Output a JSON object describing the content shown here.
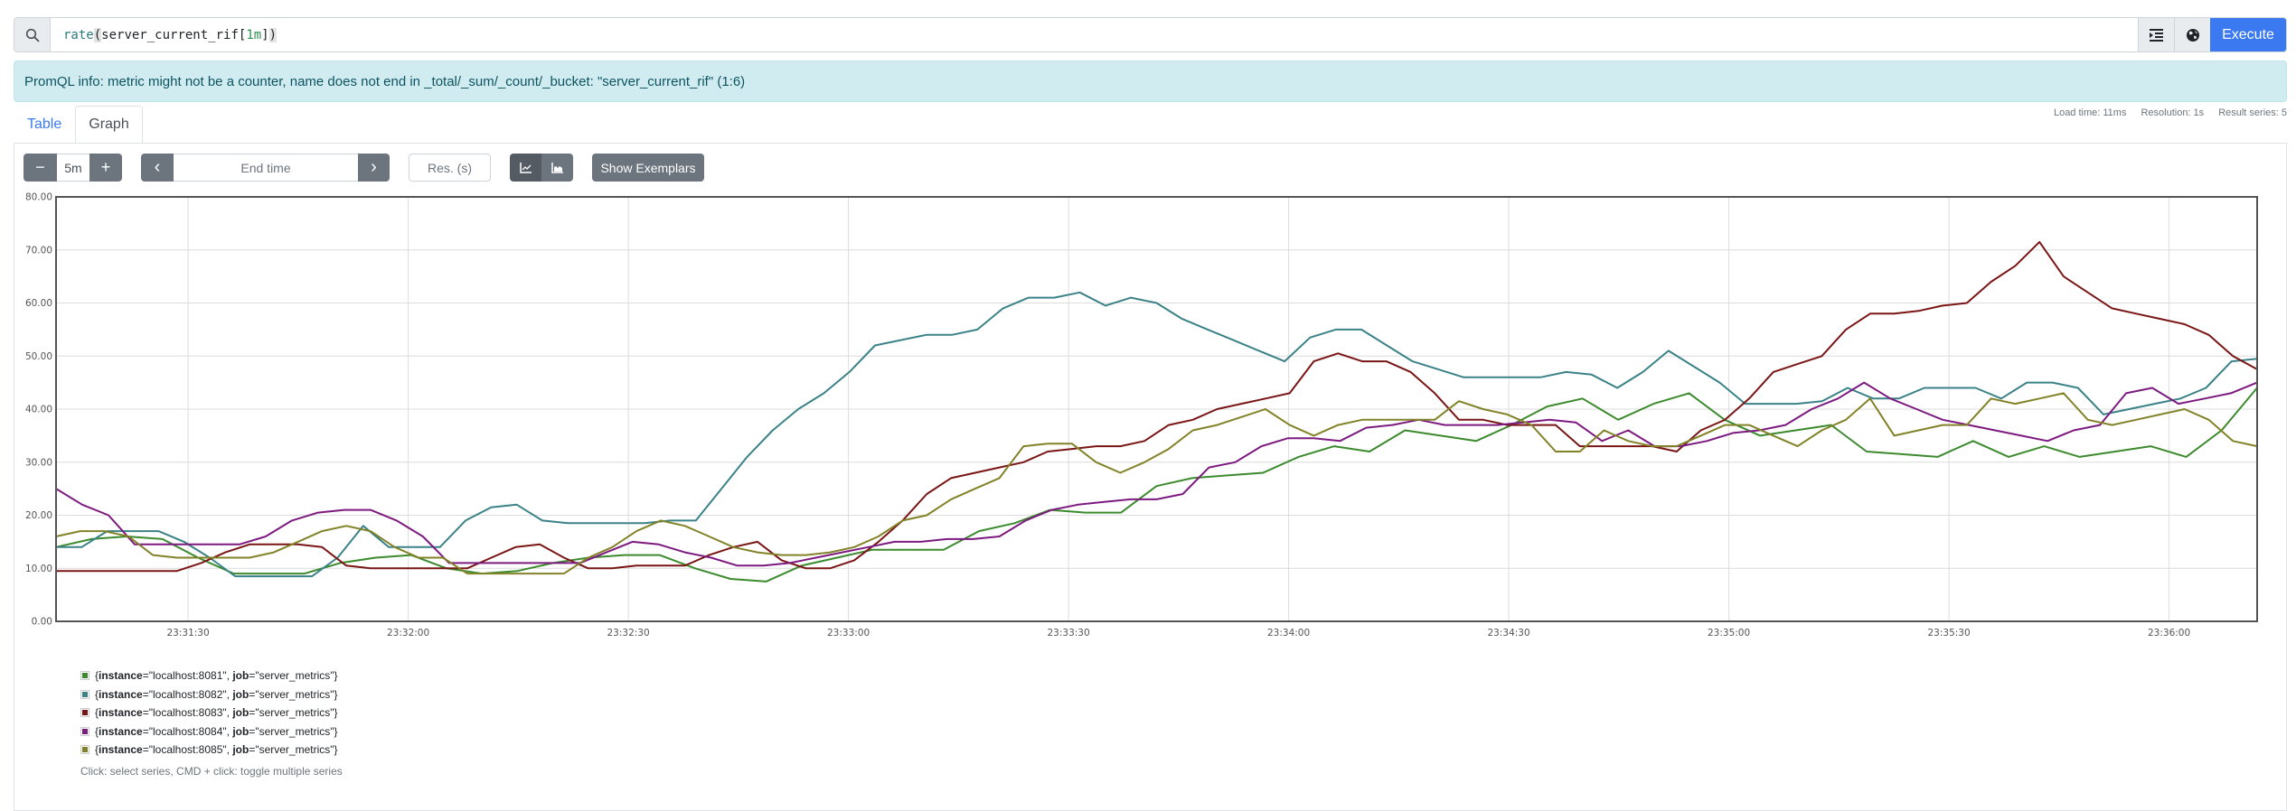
{
  "query": {
    "search_icon": "search-icon",
    "fn": "rate",
    "open_paren": "(",
    "metric": "server_current_rif",
    "open_bracket": "[",
    "range": "1m",
    "close_bracket": "]",
    "close_paren": ")",
    "format_icon": "indent-format-icon",
    "metrics_explorer_icon": "globe-icon",
    "execute_label": "Execute"
  },
  "alert": {
    "text": "PromQL info: metric might not be a counter, name does not end in _total/_sum/_count/_bucket: \"server_current_rif\" (1:6)"
  },
  "stats": {
    "load_time": "Load time: 11ms",
    "resolution": "Resolution: 1s",
    "result_series": "Result series: 5"
  },
  "tabs": [
    {
      "label": "Table",
      "active": false
    },
    {
      "label": "Graph",
      "active": true
    }
  ],
  "controls": {
    "range_minus": "−",
    "range_value": "5m",
    "range_plus": "+",
    "prev_icon": "‹",
    "end_time_placeholder": "End time",
    "next_icon": "›",
    "resolution_placeholder": "Res. (s)",
    "line_chart_icon": "line-chart-icon",
    "stacked_chart_icon": "area-chart-icon",
    "show_exemplars_label": "Show Exemplars"
  },
  "chart_data": {
    "type": "line",
    "title": "",
    "xlabel": "",
    "ylabel": "",
    "ylim": [
      0,
      80
    ],
    "yticks": [
      "0.00",
      "10.00",
      "20.00",
      "30.00",
      "40.00",
      "50.00",
      "60.00",
      "70.00",
      "80.00"
    ],
    "xticks": [
      "23:31:30",
      "23:32:00",
      "23:32:30",
      "23:33:00",
      "23:33:30",
      "23:34:00",
      "23:34:30",
      "23:35:00",
      "23:35:30",
      "23:36:00"
    ],
    "x_start": "23:31:12",
    "x_end": "23:36:12",
    "x_step_seconds": 5,
    "grid": true,
    "legend_position": "bottom-left",
    "series": [
      {
        "name": "{instance=\"localhost:8081\", job=\"server_metrics\"}",
        "instance": "localhost:8081",
        "job": "server_metrics",
        "color": "#3c8a2e",
        "values": [
          14,
          15.5,
          16,
          15.5,
          12,
          9,
          9,
          9,
          11,
          12,
          12.5,
          10,
          9,
          9.5,
          11,
          12,
          12.5,
          12.5,
          10,
          8,
          7.5,
          10.5,
          12,
          13.5,
          13.5,
          13.5,
          17,
          18.5,
          21,
          20.5,
          20.5,
          25.5,
          27,
          27.5,
          28,
          31,
          33,
          32,
          36,
          35,
          34,
          37,
          40.5,
          42,
          38,
          41,
          43,
          38,
          35,
          36,
          37,
          32,
          31.5,
          31,
          34,
          31,
          33,
          31,
          32,
          33,
          31,
          36,
          44
        ]
      },
      {
        "name": "{instance=\"localhost:8082\", job=\"server_metrics\"}",
        "instance": "localhost:8082",
        "job": "server_metrics",
        "color": "#3a8287",
        "values": [
          14,
          14,
          17,
          17,
          17,
          15,
          12,
          8.5,
          8.5,
          8.5,
          8.5,
          12,
          18,
          14,
          14,
          14,
          19,
          21.5,
          22,
          19,
          18.5,
          18.5,
          18.5,
          18.5,
          19,
          19,
          25,
          31,
          36,
          40,
          43,
          47,
          52,
          53,
          54,
          54,
          55,
          59,
          61,
          61,
          62,
          59.5,
          61,
          60,
          57,
          55,
          53,
          51,
          49,
          53.5,
          55,
          55,
          52,
          49,
          47.5,
          46,
          46,
          46,
          46,
          47,
          46.5,
          44,
          47,
          51,
          48,
          45,
          41,
          41,
          41,
          41.5,
          44,
          42,
          42,
          44,
          44,
          44,
          42,
          45,
          45,
          44,
          39,
          40,
          41,
          42,
          44,
          49,
          49.5
        ]
      },
      {
        "name": "{instance=\"localhost:8083\", job=\"server_metrics\"}",
        "instance": "localhost:8083",
        "job": "server_metrics",
        "color": "#7a1515",
        "values": [
          9.5,
          9.5,
          9.5,
          9.5,
          9.5,
          9.5,
          11,
          13,
          14.5,
          14.5,
          14.5,
          14,
          10.5,
          10,
          10,
          10,
          10,
          10,
          12,
          14,
          14.5,
          12,
          10,
          10,
          10.5,
          10.5,
          10.5,
          12.5,
          14,
          15,
          11.5,
          10,
          10,
          11.5,
          15,
          19,
          24,
          27,
          28,
          29,
          30,
          32,
          32.5,
          33,
          33,
          34,
          37,
          38,
          40,
          41,
          42,
          43,
          49,
          50.5,
          49,
          49,
          47,
          43,
          38,
          38,
          37,
          37,
          37,
          33,
          33,
          33,
          33,
          32,
          36,
          38,
          42,
          47,
          48.5,
          50,
          55,
          58,
          58,
          58.5,
          59.5,
          60,
          64,
          67,
          71.5,
          65,
          62,
          59,
          58,
          57,
          56,
          54,
          50,
          47.5
        ]
      },
      {
        "name": "{instance=\"localhost:8084\", job=\"server_metrics\"}",
        "instance": "localhost:8084",
        "job": "server_metrics",
        "color": "#7d1a80",
        "values": [
          25,
          22,
          20,
          14.5,
          14.5,
          14.5,
          14.5,
          14.5,
          16,
          19,
          20.5,
          21,
          21,
          19,
          16,
          11,
          11,
          11,
          11,
          11,
          11,
          13,
          15,
          14.5,
          13,
          12,
          10.5,
          10.5,
          11,
          12,
          13,
          14,
          15,
          15,
          15.5,
          15.5,
          16,
          19,
          21,
          22,
          22.5,
          23,
          23,
          24,
          29,
          30,
          33,
          34.5,
          34.5,
          34,
          36.5,
          37,
          38,
          37,
          37,
          37,
          37.5,
          38,
          37.5,
          34,
          36,
          33,
          33,
          34,
          35.5,
          36,
          37,
          40,
          42,
          45,
          42,
          40,
          38,
          37,
          36,
          35,
          34,
          36,
          37,
          43,
          44,
          41,
          42,
          43,
          45
        ]
      },
      {
        "name": "{instance=\"localhost:8085\", job=\"server_metrics\"}",
        "instance": "localhost:8085",
        "job": "server_metrics",
        "color": "#828228",
        "values": [
          16,
          17,
          17,
          16,
          12.5,
          12,
          12,
          12,
          12,
          13,
          15,
          17,
          18,
          17,
          14,
          12,
          12,
          9,
          9,
          9,
          9,
          9,
          12,
          14,
          17,
          19,
          18,
          16,
          14,
          13,
          12.5,
          12.5,
          13,
          14,
          16,
          19,
          20,
          23,
          25,
          27,
          33,
          33.5,
          33.5,
          30,
          28,
          30,
          32.5,
          36,
          37,
          38.5,
          40,
          37,
          35,
          37,
          38,
          38,
          38,
          38,
          41.5,
          40,
          39,
          37,
          32,
          32,
          36,
          34,
          33,
          33,
          35,
          37,
          37,
          35,
          33,
          36,
          38,
          42,
          35,
          36,
          37,
          37,
          42,
          41,
          42,
          43,
          38,
          37,
          38,
          39,
          40,
          38,
          34,
          33
        ]
      }
    ]
  },
  "legend": {
    "items": [
      {
        "key1": "instance",
        "val1": "\"localhost:8081\"",
        "key2": "job",
        "val2": "\"server_metrics\"",
        "color": "#3c8a2e"
      },
      {
        "key1": "instance",
        "val1": "\"localhost:8082\"",
        "key2": "job",
        "val2": "\"server_metrics\"",
        "color": "#3a8287"
      },
      {
        "key1": "instance",
        "val1": "\"localhost:8083\"",
        "key2": "job",
        "val2": "\"server_metrics\"",
        "color": "#7a1515"
      },
      {
        "key1": "instance",
        "val1": "\"localhost:8084\"",
        "key2": "job",
        "val2": "\"server_metrics\"",
        "color": "#7d1a80"
      },
      {
        "key1": "instance",
        "val1": "\"localhost:8085\"",
        "key2": "job",
        "val2": "\"server_metrics\"",
        "color": "#828228"
      }
    ],
    "hint": "Click: select series, CMD + click: toggle multiple series"
  }
}
